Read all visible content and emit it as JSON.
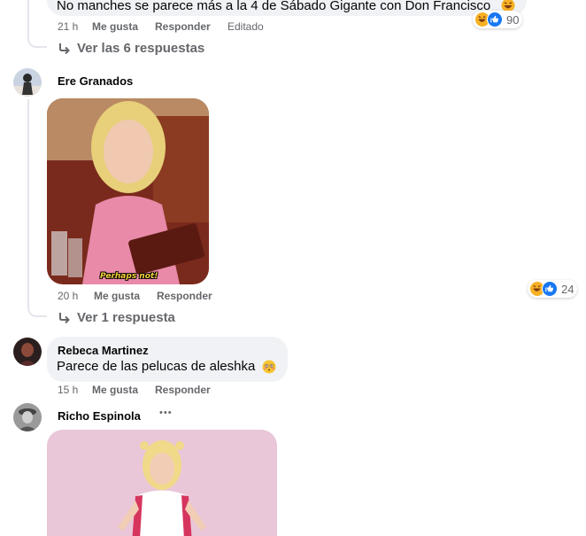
{
  "comments": [
    {
      "text": "No manches se parece más a la 4 de Sábado Gigante con Don Francisco",
      "time": "21 h",
      "like": "Me gusta",
      "reply": "Responder",
      "edited": "Editado",
      "reaction_count": "90",
      "replies_link": "Ver las 6 respuestas"
    },
    {
      "author": "Ere Granados",
      "gif_caption": "Perhaps not!",
      "time": "20 h",
      "like": "Me gusta",
      "reply": "Responder",
      "reaction_count": "24",
      "replies_link": "Ver 1 respuesta"
    },
    {
      "author": "Rebeca Martinez",
      "text": "Parece de las pelucas de aleshka",
      "time": "15 h",
      "like": "Me gusta",
      "reply": "Responder"
    },
    {
      "author": "Richo Espinola",
      "more": "•••"
    }
  ],
  "colors": {
    "bubble": "#f0f2f5",
    "meta_text": "#65676b",
    "like_blue": "#1877f2",
    "haha_yellow": "#f7b125",
    "thread_line": "#e4e6eb"
  },
  "icons": [
    "reply-arrow-icon",
    "haha-reaction-icon",
    "like-reaction-icon",
    "flushed-emoji-icon",
    "laughing-emoji-icon",
    "more-options-icon"
  ]
}
